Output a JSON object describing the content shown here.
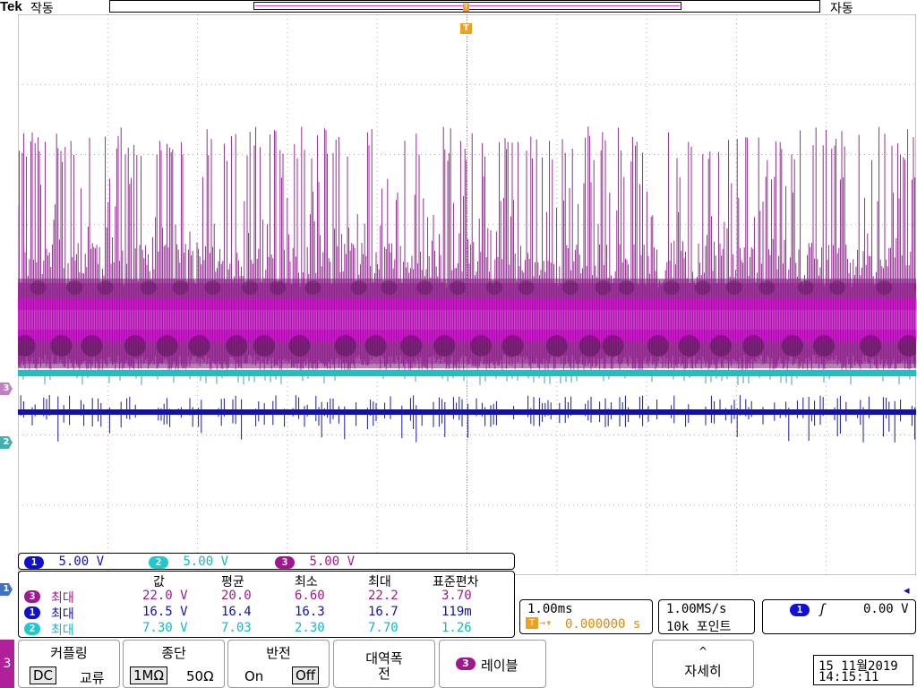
{
  "top_bar": {
    "brand": "Tek",
    "acq_state_left": "작동",
    "acq_state_right": "자동"
  },
  "trigger_marker_label": "T",
  "channel_markers": {
    "ch3": "3",
    "ch2": "2",
    "ch1": "1"
  },
  "colors": {
    "ch1": "#1010c0",
    "ch2": "#20c0c0",
    "ch3": "#b020a0",
    "ch3_bright": "#ff00ff",
    "trigger": "#f0a020"
  },
  "channel_scales": [
    {
      "ch": "1",
      "value": "5.00 V"
    },
    {
      "ch": "2",
      "value": "5.00 V"
    },
    {
      "ch": "3",
      "value": "5.00 V"
    }
  ],
  "measurements": {
    "headers": [
      "값",
      "평균",
      "최소",
      "최대",
      "표준편차"
    ],
    "rows": [
      {
        "ch": "3",
        "type": "최대",
        "value": "22.0 V",
        "mean": "20.0",
        "min": "6.60",
        "max": "22.2",
        "std": "3.70"
      },
      {
        "ch": "1",
        "type": "최대",
        "value": "16.5 V",
        "mean": "16.4",
        "min": "16.3",
        "max": "16.7",
        "std": "119m"
      },
      {
        "ch": "2",
        "type": "최대",
        "value": "7.30 V",
        "mean": "7.03",
        "min": "2.30",
        "max": "7.70",
        "std": "1.26"
      }
    ]
  },
  "timebase": {
    "scale": "1.00ms",
    "position": "0.000000 s",
    "sample_rate": "1.00MS/s",
    "record_length": "10k 포인트"
  },
  "trigger": {
    "source": "1",
    "slope_icon": "rising-edge-icon",
    "level": "0.00 V"
  },
  "menu": {
    "channel_tab": "3",
    "coupling": {
      "title": "커플링",
      "options": [
        "DC",
        "교류"
      ],
      "selected": 0
    },
    "termination": {
      "title": "종단",
      "options": [
        "1MΩ",
        "50Ω"
      ],
      "selected": 0
    },
    "invert": {
      "title": "반전",
      "options": [
        "On",
        "Off"
      ],
      "selected": 1
    },
    "bandwidth": {
      "title": "대역폭",
      "value": "전"
    },
    "label": {
      "ch": "3",
      "title": "레이블"
    },
    "more": {
      "arrow": "^",
      "title": "자세히"
    }
  },
  "datetime": {
    "date": "15 11월2019",
    "time": "14:15:11"
  }
}
